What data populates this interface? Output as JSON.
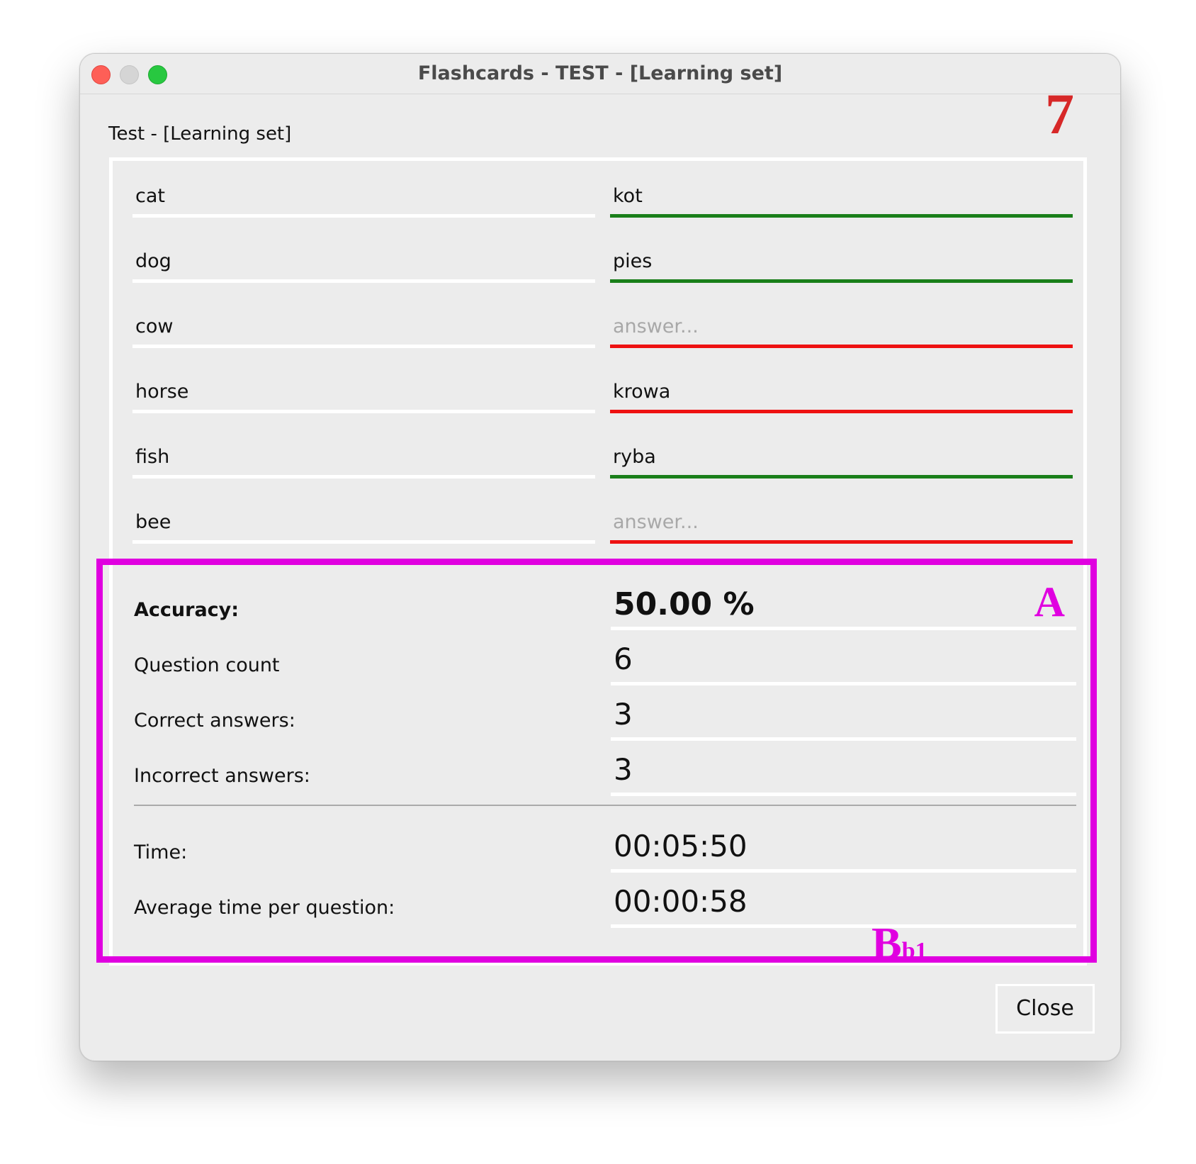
{
  "window": {
    "title": "Flashcards - TEST - [Learning set]"
  },
  "annotations": {
    "step_number": "7",
    "stats_label": "A",
    "button_label_main": "B",
    "button_label_sub": "b1",
    "color_step": "#d72828",
    "color_overlay": "#e000e0"
  },
  "test": {
    "heading": "Test - [Learning set]",
    "questions": [
      {
        "term": "cat",
        "answer": "kot",
        "status": "correct"
      },
      {
        "term": "dog",
        "answer": "pies",
        "status": "correct"
      },
      {
        "term": "cow",
        "answer": "",
        "status": "incorrect"
      },
      {
        "term": "horse",
        "answer": "krowa",
        "status": "incorrect"
      },
      {
        "term": "fish",
        "answer": "ryba",
        "status": "correct"
      },
      {
        "term": "bee",
        "answer": "",
        "status": "incorrect"
      }
    ],
    "answer_placeholder": "answer...",
    "colors": {
      "correct": "#1a7f1a",
      "incorrect": "#ee1111"
    }
  },
  "stats": {
    "accuracy_label": "Accuracy:",
    "accuracy_value": "50.00 %",
    "question_count_label": "Question count",
    "question_count_value": "6",
    "correct_label": "Correct answers:",
    "correct_value": "3",
    "incorrect_label": "Incorrect answers:",
    "incorrect_value": "3",
    "time_label": "Time:",
    "time_value": "00:05:50",
    "avg_time_label": "Average time per question:",
    "avg_time_value": "00:00:58"
  },
  "footer": {
    "close_label": "Close"
  }
}
